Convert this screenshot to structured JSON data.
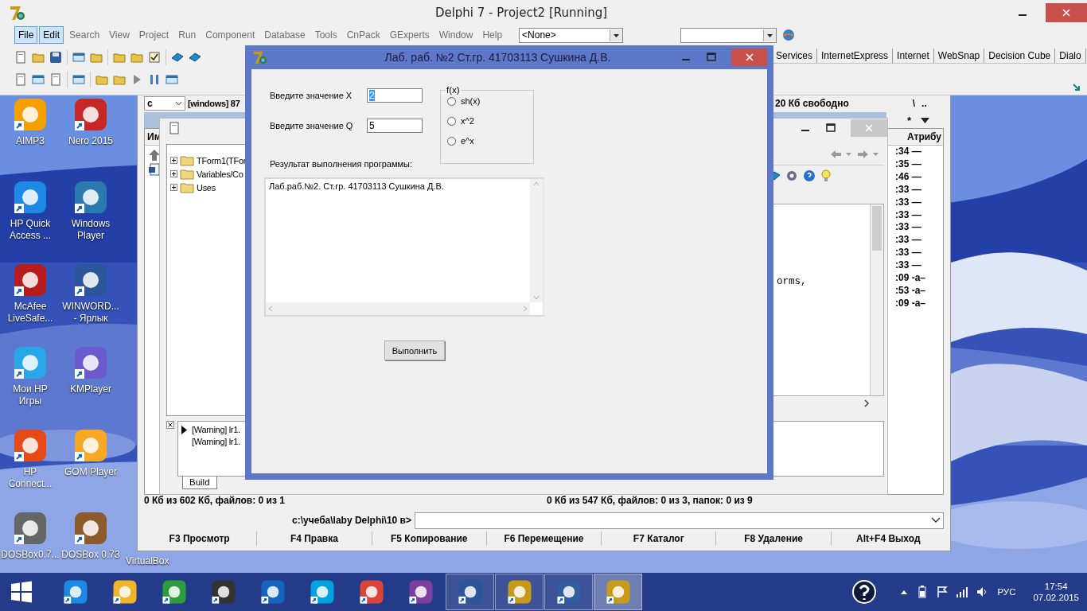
{
  "desktop": {
    "icons": [
      {
        "label": "AIMP3"
      },
      {
        "label": "Nero 2015"
      },
      {
        "label": "HP Quick Access ..."
      },
      {
        "label": "Windows Player"
      },
      {
        "label": "McAfee LiveSafe..."
      },
      {
        "label": "WINWORD... - Ярлык"
      },
      {
        "label": "Мои HP Игры"
      },
      {
        "label": "KMPlayer"
      },
      {
        "label": "HP Connect..."
      },
      {
        "label": "GOM Player"
      },
      {
        "label": "DOSBox0.7..."
      },
      {
        "label": "DOSBox 0.73"
      }
    ],
    "partial_label": "VirtualBox"
  },
  "ide": {
    "title": "Delphi 7 - Project2 [Running]",
    "menu": [
      {
        "label": "File",
        "selected": true
      },
      {
        "label": "Edit",
        "selected": true
      },
      {
        "label": "Search",
        "selected": false
      },
      {
        "label": "View",
        "selected": false
      },
      {
        "label": "Project",
        "selected": false
      },
      {
        "label": "Run",
        "selected": false
      },
      {
        "label": "Component",
        "selected": false
      },
      {
        "label": "Database",
        "selected": false
      },
      {
        "label": "Tools",
        "selected": false
      },
      {
        "label": "CnPack",
        "selected": false
      },
      {
        "label": "GExperts",
        "selected": false
      },
      {
        "label": "Window",
        "selected": false
      },
      {
        "label": "Help",
        "selected": false
      }
    ],
    "target_combo": "<None>",
    "palette_tabs": [
      "Services",
      "InternetExpress",
      "Internet",
      "WebSnap",
      "Decision Cube",
      "Dialo"
    ]
  },
  "file_manager": {
    "drive": "c",
    "volume": "[windows]  87",
    "free_space": "20 Кб свободно",
    "root": "\\",
    "up": "..",
    "filter": "*",
    "name_header": "Им",
    "attr_header": "Атрибу",
    "times": [
      ":34 —",
      ":35 —",
      ":46 —",
      ":33 —",
      ":33 —",
      ":33 —",
      ":33 —",
      ":33 —",
      ":33 —",
      ":33 —",
      ":09 -a–",
      ":53 -a–",
      ":09 -a–"
    ],
    "status_left": "0 Кб из 602 Кб, файлов: 0 из 1",
    "status_right": "0 Кб из 547 Кб, файлов: 0 из 3, папок: 0 из 9",
    "prompt": "c:\\учеба\\laby Delphi\\10 в>",
    "function_keys": [
      "F3 Просмотр",
      "F4 Правка",
      "F5 Копирование",
      "F6 Перемещение",
      "F7 Каталог",
      "F8 Удаление",
      "Alt+F4 Выход"
    ]
  },
  "editor": {
    "tree": [
      {
        "label": "TForm1(TFor",
        "expanded": false
      },
      {
        "label": "Variables/Co",
        "expanded": false
      },
      {
        "label": "Uses",
        "expanded": false
      }
    ],
    "code_fragment": "orms,",
    "messages": [
      "[Warning] lr1.",
      "[Warning] lr1."
    ],
    "tab": "Build"
  },
  "form": {
    "title": "Лаб. раб. №2 Ст.гр.  41703113 Сушкина Д.В.",
    "fields": [
      {
        "label": "Введите значение X",
        "value": "2",
        "selected": true
      },
      {
        "label": "Введите значение Q",
        "value": "5",
        "selected": false
      }
    ],
    "group": {
      "title": "f(x)",
      "options": [
        {
          "label": "sh(x)",
          "selected": false
        },
        {
          "label": "x^2",
          "selected": false
        },
        {
          "label": "e^x",
          "selected": false
        }
      ]
    },
    "result_label": "Результат выполнения программы:",
    "result_text": "Лаб.раб.№2. Ст.гр. 41703113 Сушкина Д.В.",
    "button": "Выполнить"
  },
  "taskbar": {
    "apps": [
      {
        "open": false,
        "selected": false
      },
      {
        "open": false,
        "selected": false
      },
      {
        "open": false,
        "selected": false
      },
      {
        "open": false,
        "selected": false
      },
      {
        "open": false,
        "selected": false
      },
      {
        "open": false,
        "selected": false
      },
      {
        "open": false,
        "selected": false
      },
      {
        "open": false,
        "selected": false
      },
      {
        "open": true,
        "selected": false
      },
      {
        "open": true,
        "selected": false
      },
      {
        "open": true,
        "selected": false
      },
      {
        "open": true,
        "selected": true
      }
    ],
    "language": "РУС",
    "time": "17:54",
    "date": "07.02.2015"
  }
}
